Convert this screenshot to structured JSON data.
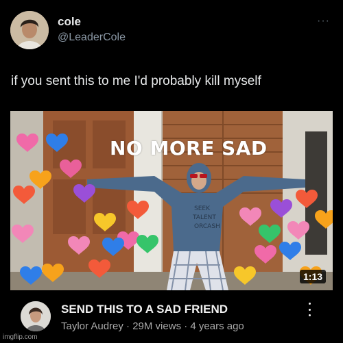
{
  "tweet": {
    "author_name": "cole",
    "author_handle": "@LeaderCole",
    "more_label": "···",
    "text": "if you sent this to me I'd probably kill myself"
  },
  "video": {
    "overlay_title": "NO MORE SAD",
    "duration": "1:13",
    "title": "SEND THIS TO A SAD FRIEND",
    "meta": "Taylor Audrey · 29M views · 4 years ago"
  },
  "watermark": "imgflip.com"
}
